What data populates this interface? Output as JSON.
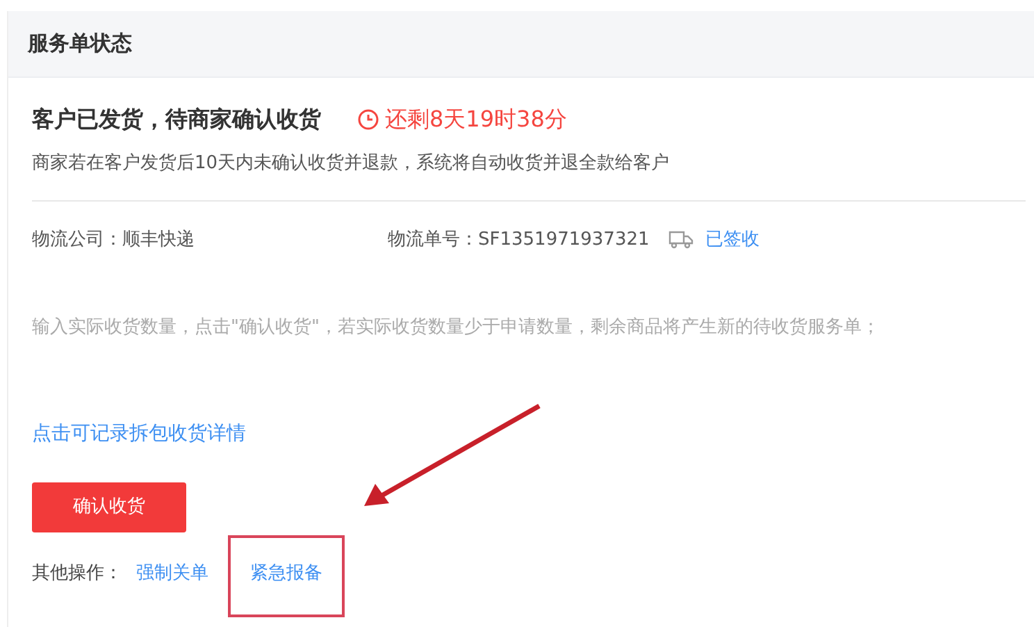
{
  "panel": {
    "title": "服务单状态"
  },
  "status": {
    "title": "客户已发货，待商家确认收货",
    "countdown": "还剩8天19时38分",
    "note": "商家若在客户发货后10天内未确认收货并退款，系统将自动收货并退全款给客户"
  },
  "logistics": {
    "company_label": "物流公司：",
    "company": "顺丰快递",
    "number_label": "物流单号：",
    "number": "SF1351971937321",
    "state": "已签收"
  },
  "hint": "输入实际收货数量，点击\"确认收货\"，若实际收货数量少于申请数量，剩余商品将产生新的待收货服务单；",
  "detail_link": "点击可记录拆包收货详情",
  "confirm_button": "确认收货",
  "other_actions": {
    "label": "其他操作：",
    "links": [
      {
        "text": "强制关单",
        "highlighted": false
      },
      {
        "text": "紧急报备",
        "highlighted": true
      }
    ]
  },
  "annotations": [
    {
      "kind": "arrow"
    }
  ]
}
